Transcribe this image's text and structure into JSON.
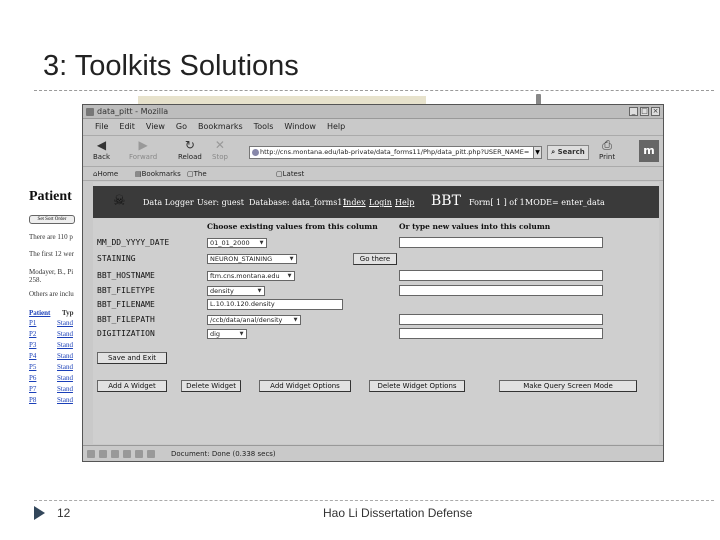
{
  "slide": {
    "title": "3: Toolkits Solutions",
    "page_number": "12",
    "footer": "Hao Li Dissertation Defense"
  },
  "background_page": {
    "heading": "Patient",
    "sort_button": "Set Sort Order",
    "lines": [
      "There are 110 p",
      "The first 12 wer",
      "Modayer, B., Pi",
      "258.",
      "Others are inclu"
    ],
    "table_headers": [
      "Patient",
      "Typ"
    ],
    "rows": [
      {
        "id": "P1",
        "type": "Stand"
      },
      {
        "id": "P2",
        "type": "Stand"
      },
      {
        "id": "P3",
        "type": "Stand"
      },
      {
        "id": "P4",
        "type": "Stand"
      },
      {
        "id": "P5",
        "type": "Stand"
      },
      {
        "id": "P6",
        "type": "Stand"
      },
      {
        "id": "P7",
        "type": "Stand"
      },
      {
        "id": "P8",
        "type": "Stand"
      }
    ]
  },
  "browser": {
    "window_title": "data_pitt - Mozilla",
    "menu": [
      "File",
      "Edit",
      "View",
      "Go",
      "Bookmarks",
      "Tools",
      "Window",
      "Help"
    ],
    "nav": {
      "back": "Back",
      "forward": "Forward",
      "reload": "Reload",
      "stop": "Stop",
      "print": "Print"
    },
    "url": "http://cns.montana.edu/lab-private/data_forms11/Php/data_pitt.php?USER_NAME=",
    "search": "Search",
    "bookmarks": [
      "Home",
      "Bookmarks",
      "The Mozilla Organiza...",
      "Latest Builds"
    ],
    "status": "Document: Done (0.338 secs)"
  },
  "app": {
    "logo_name": "Data Logger",
    "user": "User: guest",
    "database": "Database: data_forms11",
    "index": "Index",
    "login": "Login",
    "help": "Help",
    "bbt": "BBT",
    "form": "Form[ 1 ] of 1",
    "mode": "MODE= enter_data",
    "col_choose": "Choose existing values from this column",
    "col_new": "Or type new values into this column",
    "fields": [
      {
        "label": "MM_DD_YYYY_DATE",
        "select": "01_01_2000"
      },
      {
        "label": "STAINING",
        "select": "NEURON_STAINING"
      },
      {
        "label": "BBT_HOSTNAME",
        "select": "ftm.cns.montana.edu"
      },
      {
        "label": "BBT_FILETYPE",
        "select": "density"
      },
      {
        "label": "BBT_FILENAME",
        "text": "L.10.10.120.density"
      },
      {
        "label": "BBT_FILEPATH",
        "select": "/ccb/data/anal/density"
      },
      {
        "label": "DIGITIZATION",
        "select": "dig"
      }
    ],
    "go_there": "Go there",
    "save_exit": "Save and Exit",
    "actions": [
      "Add A Widget",
      "Delete Widget",
      "Add Widget Options",
      "Delete Widget Options",
      "Make Query Screen Mode"
    ]
  }
}
